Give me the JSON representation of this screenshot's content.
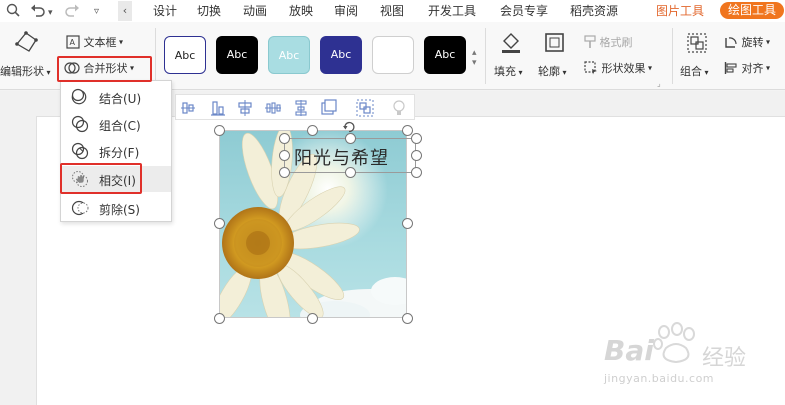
{
  "tabs": [
    {
      "id": "design",
      "label": "设计"
    },
    {
      "id": "transitions",
      "label": "切换"
    },
    {
      "id": "animation",
      "label": "动画"
    },
    {
      "id": "slideshow",
      "label": "放映"
    },
    {
      "id": "review",
      "label": "审阅"
    },
    {
      "id": "view",
      "label": "视图"
    },
    {
      "id": "developer",
      "label": "开发工具"
    },
    {
      "id": "member",
      "label": "会员专享"
    },
    {
      "id": "resources",
      "label": "稻壳资源"
    },
    {
      "id": "picture_tools",
      "label": "图片工具"
    },
    {
      "id": "drawing_tools",
      "label": "绘图工具"
    }
  ],
  "ribbon": {
    "edit_shape": "编辑形状",
    "textbox": "文本框",
    "merge_shapes": "合并形状",
    "style_presets": [
      "Abc",
      "Abc",
      "Abc",
      "Abc",
      "",
      "Abc"
    ],
    "fill": "填充",
    "outline": "轮廓",
    "format_painter": "格式刷",
    "shape_effects": "形状效果",
    "group": "组合",
    "rotate": "旋转",
    "align": "对齐"
  },
  "merge_menu": {
    "items": [
      {
        "id": "union",
        "label": "结合(U)"
      },
      {
        "id": "combine",
        "label": "组合(C)"
      },
      {
        "id": "fragment",
        "label": "拆分(F)"
      },
      {
        "id": "intersect",
        "label": "相交(I)"
      },
      {
        "id": "subtract",
        "label": "剪除(S)"
      }
    ]
  },
  "slide": {
    "title_text": "阳光与希望"
  },
  "watermark": {
    "brand": "Bai",
    "brand_suffix": "经验",
    "url": "jingyan.baidu.com"
  },
  "colors": {
    "accent_orange": "#f0751e",
    "picture_tools_text": "#e2672d",
    "highlight_red": "#e0302a",
    "preset_navy": "#2e3192",
    "preset_teal": "#a9dde2"
  }
}
